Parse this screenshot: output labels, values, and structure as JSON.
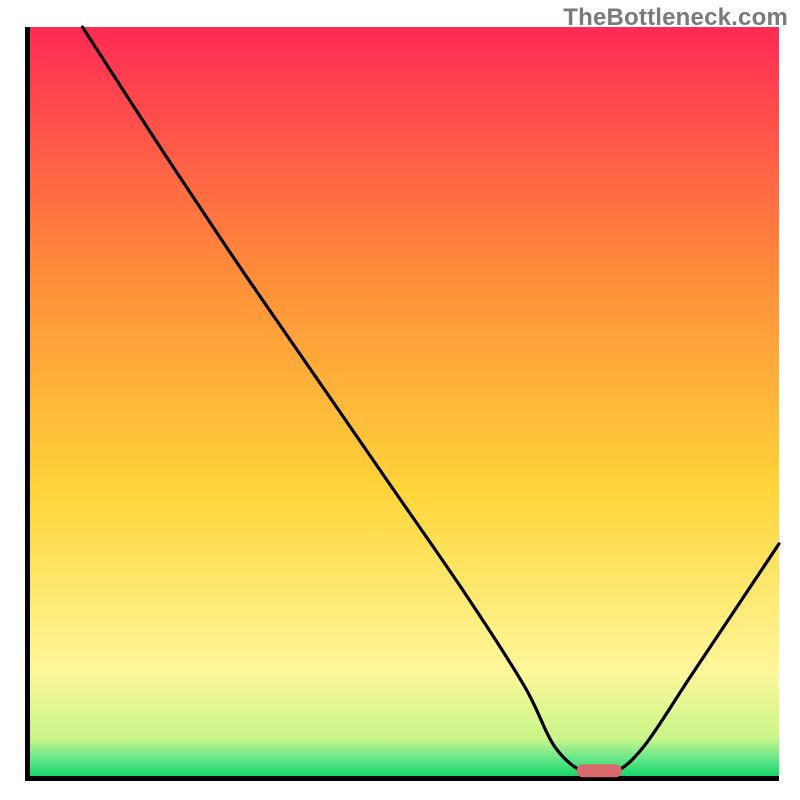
{
  "watermark": "TheBottleneck.com",
  "chart_data": {
    "type": "line",
    "title": "",
    "xlabel": "",
    "ylabel": "",
    "xlim": [
      0,
      100
    ],
    "ylim": [
      0,
      100
    ],
    "grid": false,
    "legend": false,
    "series": [
      {
        "name": "bottleneck-curve",
        "x": [
          7,
          18,
          28,
          38,
          48,
          58,
          66,
          70,
          74,
          78,
          82,
          88,
          94,
          100
        ],
        "y": [
          100,
          83,
          68,
          53.5,
          39,
          24.5,
          12,
          4,
          0.5,
          0.5,
          4,
          13,
          22,
          31
        ]
      }
    ],
    "marker": {
      "name": "optimum-marker",
      "x_start": 73,
      "x_end": 79,
      "y": 0.7,
      "color": "#d86a6d"
    },
    "background_gradient": {
      "top": "#ff2a55",
      "mid_upper": "#ff8a3a",
      "mid": "#ffd53a",
      "mid_lower": "#fff79a",
      "green_band": "#6de88a",
      "bottom": "#17d66a"
    }
  }
}
